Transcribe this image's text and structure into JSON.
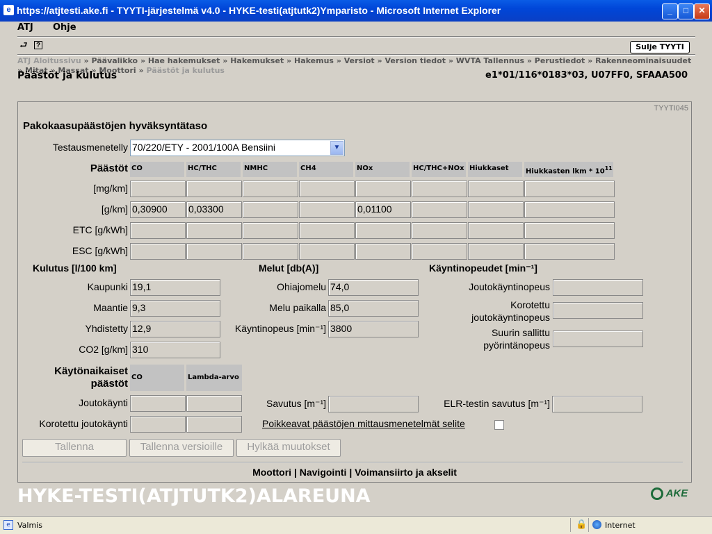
{
  "window": {
    "title": "https://atjtesti.ake.fi - TYYTI-järjestelmä v4.0 - HYKE-testi(atjtutk2)Ymparisto - Microsoft Internet Explorer",
    "minimize": "_",
    "maximize": "□",
    "close": "✕"
  },
  "menubar": {
    "atj": "ATJ",
    "ohje": "Ohje"
  },
  "toolbar": {
    "back_glyph": "⮐",
    "help_glyph": "?",
    "close_button": "Sulje TYYTI"
  },
  "breadcrumb": {
    "items": [
      "ATJ Aloitussivu",
      "Päävalikko",
      "Hae hakemukset",
      "Hakemukset",
      "Hakemus",
      "Versiot",
      "Version tiedot",
      "WVTA Tallennus",
      "Perustiedot",
      "Rakenneominaisuudet",
      "Mitat",
      "Massat",
      "Moottori",
      "Päästöt ja kulutus"
    ],
    "separator": "»"
  },
  "page": {
    "title": "Päästöt ja kulutus",
    "id_code": "e1*01/116*0183*03, U07FF0, SFAAA500",
    "screen_code": "TYYTI045"
  },
  "emissions": {
    "section_title": "Pakokaasupäästöjen hyväksyntätaso",
    "test_method_label": "Testausmenetelly",
    "test_method_value": "70/220/ETY - 2001/100A Bensiini",
    "row_header": "Päästöt",
    "columns": [
      "CO",
      "HC/THC",
      "NMHC",
      "CH4",
      "NOx",
      "HC/THC+NOx",
      "Hiukkaset",
      "Hiukkasten lkm * 10"
    ],
    "column_superscript": "11",
    "rows": [
      {
        "label": "[mg/km]",
        "values": [
          "",
          "",
          "",
          "",
          "",
          "",
          "",
          ""
        ]
      },
      {
        "label": "[g/km]",
        "values": [
          "0,30900",
          "0,03300",
          "",
          "",
          "0,01100",
          "",
          "",
          ""
        ]
      },
      {
        "label": "ETC [g/kWh]",
        "values": [
          "",
          "",
          "",
          "",
          "",
          "",
          "",
          ""
        ]
      },
      {
        "label": "ESC [g/kWh]",
        "values": [
          "",
          "",
          "",
          "",
          "",
          "",
          "",
          ""
        ]
      }
    ]
  },
  "consumption": {
    "title": "Kulutus [l/100 km]",
    "fields": [
      {
        "label": "Kaupunki",
        "value": "19,1"
      },
      {
        "label": "Maantie",
        "value": "9,3"
      },
      {
        "label": "Yhdistetty",
        "value": "12,9"
      },
      {
        "label": "CO2 [g/km]",
        "value": "310"
      }
    ]
  },
  "noise": {
    "title": "Melut [db(A)]",
    "fields": [
      {
        "label": "Ohiajomelu",
        "value": "74,0"
      },
      {
        "label": "Melu paikalla",
        "value": "85,0"
      },
      {
        "label": "Käyntinopeus [min⁻¹]",
        "value": "3800"
      }
    ]
  },
  "speeds": {
    "title": "Käyntinopeudet [min⁻¹]",
    "fields": [
      {
        "label": "Joutokäyntinopeus",
        "value": ""
      },
      {
        "label": "Korotettu joutokäyntinopeus",
        "value": ""
      },
      {
        "label": "Suurin sallittu pyörintänopeus",
        "value": ""
      }
    ]
  },
  "operational": {
    "title": "Käytönaikaiset päästöt",
    "columns": [
      "CO",
      "Lambda-arvo"
    ],
    "rows": [
      {
        "label": "Joutokäynti",
        "values": [
          "",
          ""
        ]
      },
      {
        "label": "Korotettu joutokäynti",
        "values": [
          "",
          ""
        ]
      }
    ],
    "smoke_label": "Savutus [m⁻¹]",
    "smoke_value": "",
    "elr_label": "ELR-testin savutus [m⁻¹]",
    "elr_value": "",
    "deviating_methods_link": "Poikkeavat päästöjen mittausmenetelmät selite"
  },
  "actions": {
    "save": "Tallenna",
    "save_versions": "Tallenna versioille",
    "reject": "Hylkää muutokset"
  },
  "footer_nav": {
    "moottori": "Moottori",
    "navigointi": "Navigointi",
    "voimansiirto": "Voimansiirto ja akselit",
    "sep": "|"
  },
  "banner": {
    "text": "HYKE-TESTI(ATJTUTK2)ALAREUNA",
    "logo": "AKE"
  },
  "statusbar": {
    "status": "Valmis",
    "zone": "Internet"
  }
}
